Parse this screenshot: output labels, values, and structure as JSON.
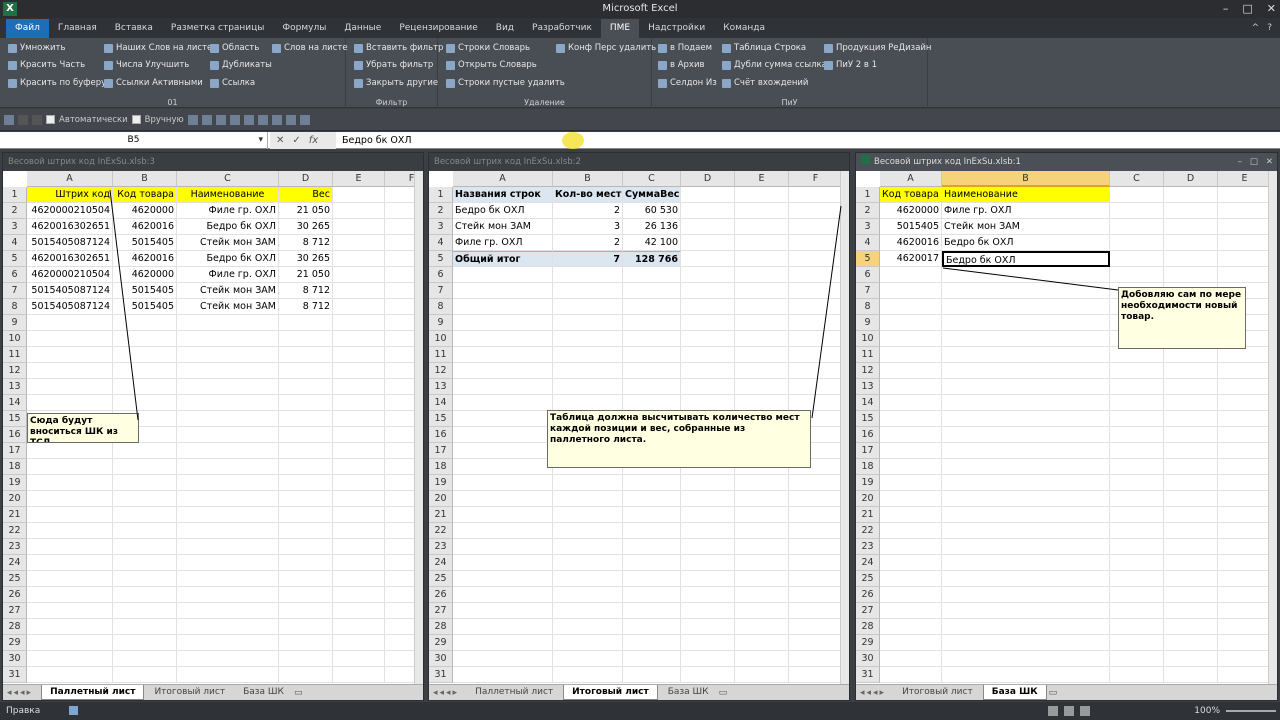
{
  "window": {
    "title": "Microsoft Excel"
  },
  "ribbon_tabs": [
    "Главная",
    "Вставка",
    "Разметка страницы",
    "Формулы",
    "Данные",
    "Рецензирование",
    "Вид",
    "Разработчик",
    "ПМЕ",
    "Надстройки",
    "Команда"
  ],
  "file_tab": "Файл",
  "ribbon": {
    "g01": {
      "label": "01",
      "items": [
        "Умножить",
        "Красить Часть",
        "Красить по буферу",
        "Наших Слов на листе",
        "Числа Улучшить",
        "Ссылки Активными",
        "Область",
        "Дубликаты",
        "Ссылка",
        "Слов на листе"
      ]
    },
    "filter": {
      "label": "Фильтр",
      "items": [
        "Вставить фильтр",
        "Убрать фильтр",
        "Закрыть другие"
      ]
    },
    "delete": {
      "label": "Удаление",
      "items": [
        "Строки Словарь",
        "Открыть Словарь",
        "Строки пустые удалить",
        "Конф Перс удалить"
      ]
    },
    "piu": {
      "label": "ПиУ",
      "items": [
        "в Подаем",
        "в Архив",
        "Селдон Из",
        "Таблица Строка",
        "Дубли сумма ссылка",
        "Счёт вхождений",
        "Продукция РеДизайн",
        "ПиУ 2 в 1"
      ]
    }
  },
  "qat": {
    "auto": "Автоматически",
    "manual": "Вручную"
  },
  "formula_bar": {
    "name_box": "B5",
    "value": "Бедро бк ОХЛ"
  },
  "pane1": {
    "title": "Весовой штрих код InExSu.xlsb:3",
    "cols": [
      "A",
      "B",
      "C",
      "D",
      "E",
      "F"
    ],
    "header": [
      "Штрих код",
      "Код товара",
      "Наименование",
      "Вес"
    ],
    "rows": [
      [
        "4620000210504",
        "4620000",
        "Филе гр. ОХЛ",
        "21 050"
      ],
      [
        "4620016302651",
        "4620016",
        "Бедро бк ОХЛ",
        "30 265"
      ],
      [
        "5015405087124",
        "5015405",
        "Стейк мон ЗАМ",
        "8 712"
      ],
      [
        "4620016302651",
        "4620016",
        "Бедро бк ОХЛ",
        "30 265"
      ],
      [
        "4620000210504",
        "4620000",
        "Филе гр. ОХЛ",
        "21 050"
      ],
      [
        "5015405087124",
        "5015405",
        "Стейк мон ЗАМ",
        "8 712"
      ],
      [
        "5015405087124",
        "5015405",
        "Стейк мон ЗАМ",
        "8 712"
      ]
    ],
    "note": "Сюда будут вноситься ШК из ТСД",
    "tabs": [
      "Паллетный лист",
      "Итоговый лист",
      "База ШК"
    ],
    "current_tab": 0
  },
  "pane2": {
    "title": "Весовой штрих код InExSu.xlsb:2",
    "cols": [
      "A",
      "B",
      "C",
      "D",
      "E",
      "F"
    ],
    "header": [
      "Названия строк",
      "Кол-во мест",
      "СуммаВес"
    ],
    "rows": [
      [
        "Бедро бк ОХЛ",
        "2",
        "60 530"
      ],
      [
        "Стейк мон ЗАМ",
        "3",
        "26 136"
      ],
      [
        "Филе гр. ОХЛ",
        "2",
        "42 100"
      ]
    ],
    "total": [
      "Общий итог",
      "7",
      "128 766"
    ],
    "note": "Таблица должна высчитывать количество мест каждой позиции и вес, собранные из паллетного листа.",
    "tabs": [
      "Паллетный лист",
      "Итоговый лист",
      "База ШК"
    ],
    "current_tab": 1
  },
  "pane3": {
    "title": "Весовой штрих код InExSu.xlsb:1",
    "cols": [
      "A",
      "B",
      "C",
      "D",
      "E"
    ],
    "header": [
      "Код товара",
      "Наименование"
    ],
    "rows": [
      [
        "4620000",
        "Филе гр. ОХЛ"
      ],
      [
        "5015405",
        "Стейк мон ЗАМ"
      ],
      [
        "4620016",
        "Бедро бк ОХЛ"
      ],
      [
        "4620017",
        "Бедро бк ОХЛ"
      ]
    ],
    "note": "Добовляю сам по мере необходимости новый товар.",
    "tabs": [
      "Итоговый лист",
      "База ШК"
    ],
    "current_tab": 1
  },
  "row_numbers": [
    "1",
    "2",
    "3",
    "4",
    "5",
    "6",
    "7",
    "8",
    "9",
    "10",
    "11",
    "12",
    "13",
    "14",
    "15",
    "16",
    "17",
    "18",
    "19",
    "20",
    "21",
    "22",
    "23",
    "24",
    "25",
    "26",
    "27",
    "28",
    "29",
    "30",
    "31"
  ],
  "status": {
    "mode": "Правка",
    "zoom": "100%"
  },
  "colors": {
    "highlight": "#ffff00",
    "pivot": "#dce6f1",
    "file_tab": "#1d6db9"
  }
}
